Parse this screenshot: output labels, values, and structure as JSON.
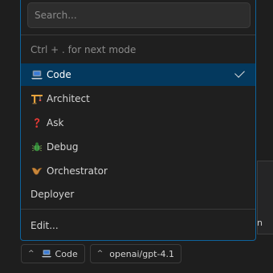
{
  "search": {
    "placeholder": "Search..."
  },
  "hint": "Ctrl + . for next mode",
  "modes": [
    {
      "label": "Code",
      "icon": "laptop-icon",
      "selected": true
    },
    {
      "label": "Architect",
      "icon": "construction-crane-icon",
      "selected": false
    },
    {
      "label": "Ask",
      "icon": "question-mark-icon",
      "selected": false
    },
    {
      "label": "Debug",
      "icon": "bug-icon",
      "selected": false
    },
    {
      "label": "Orchestrator",
      "icon": "boomerang-icon",
      "selected": false
    },
    {
      "label": "Deployer",
      "icon": "",
      "selected": false
    }
  ],
  "edit_label": "Edit...",
  "background_partial_text": "n",
  "bottom_bar": {
    "mode_chip": {
      "label": "Code",
      "icon": "laptop-icon"
    },
    "model_chip": {
      "label": "openai/gpt-4.1"
    }
  },
  "colors": {
    "accent_border": "#0e639c",
    "selected_bg": "#04395e",
    "background": "#1e1e1e"
  }
}
